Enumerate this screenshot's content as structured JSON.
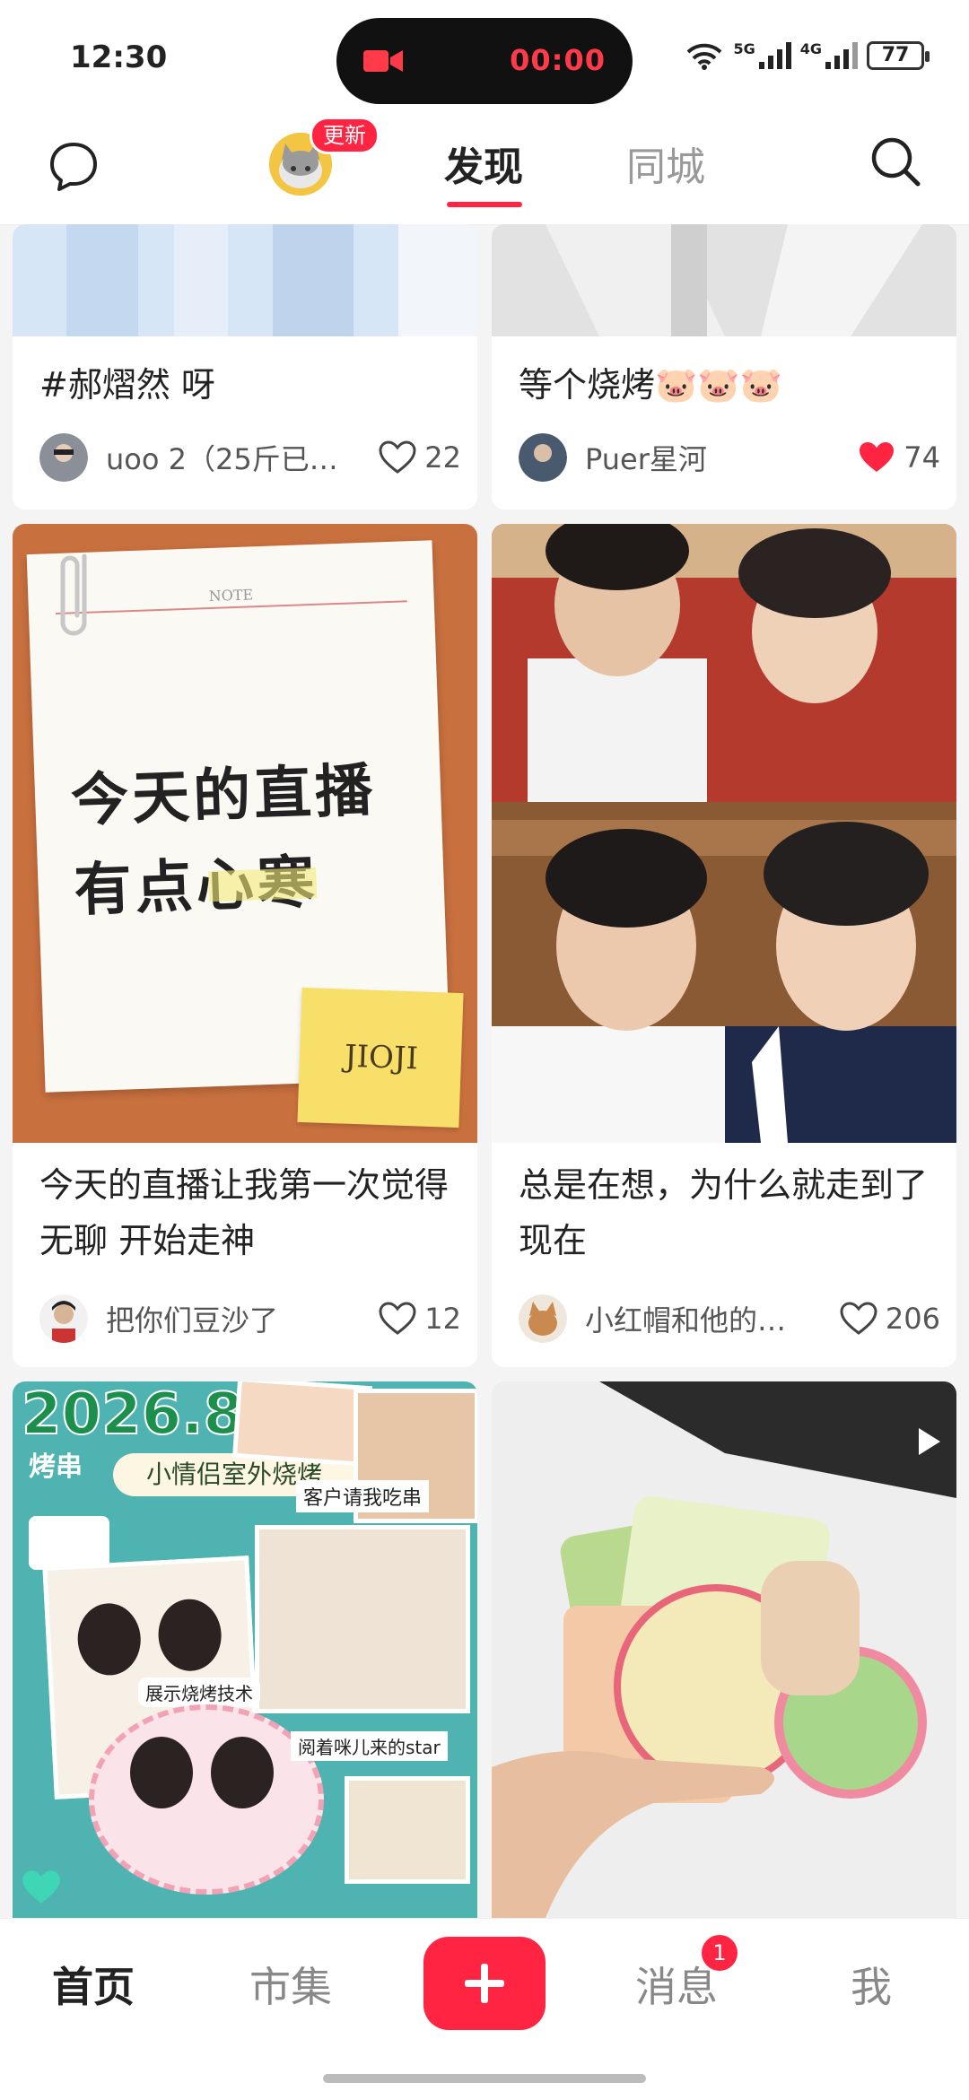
{
  "status_bar": {
    "time": "12:30",
    "recording_time": "00:00",
    "signal_1_label": "5G",
    "signal_2_label": "4G",
    "battery": "77"
  },
  "top_nav": {
    "update_badge": "更新",
    "tabs": [
      {
        "label": "发现",
        "active": true
      },
      {
        "label": "同城",
        "active": false
      }
    ]
  },
  "feed": {
    "cards": [
      {
        "title": "#郝熠然 呀",
        "author": "uoo 2（25斤已…",
        "likes": "22",
        "liked": false
      },
      {
        "title": "等个烧烤🐷🐷🐷",
        "author": "Puer星河",
        "likes": "74",
        "liked": true
      },
      {
        "title": "今天的直播让我第一次觉得无聊 开始走神",
        "author": "把你们豆沙了",
        "likes": "12",
        "liked": false,
        "image_text": {
          "note_header": "NOTE",
          "line1": "今天的直播",
          "line2": "有点心寒",
          "sticky": "JIOJI"
        }
      },
      {
        "title": "总是在想，为什么就走到了现在",
        "author": "小红帽和他的…",
        "likes": "206",
        "liked": false
      },
      {
        "image_text": {
          "date": "2026.8.4",
          "tag": "烤串",
          "caption": "小情侣室外烧烤",
          "sub1": "客户请我吃串",
          "sub2": "展示烧烤技术",
          "sub3": "阅着咪儿来的star"
        }
      },
      {
        "image_text": {}
      }
    ]
  },
  "bottom_nav": {
    "items": [
      "首页",
      "市集",
      "消息",
      "我"
    ],
    "message_badge": "1"
  },
  "colors": {
    "accent": "#ff2442"
  }
}
